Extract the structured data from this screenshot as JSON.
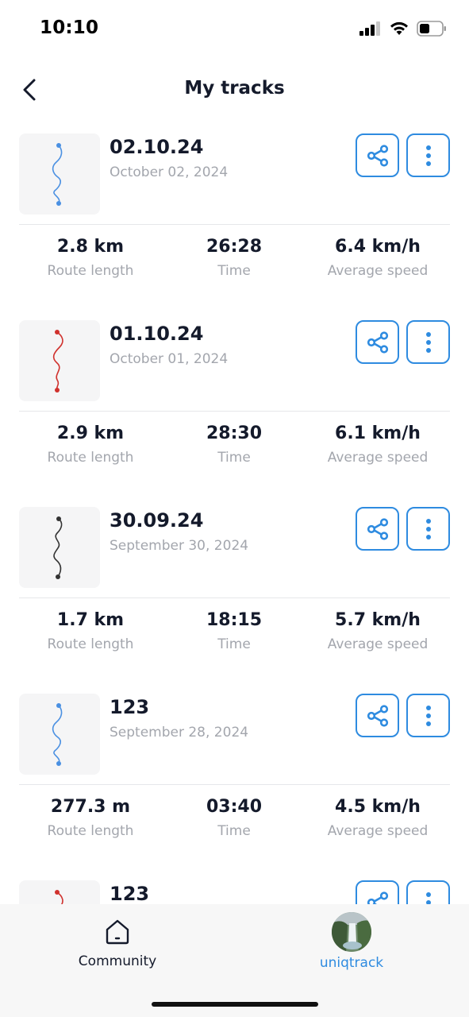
{
  "status_bar": {
    "time": "10:10"
  },
  "nav": {
    "title": "My tracks"
  },
  "labels": {
    "route_length": "Route length",
    "time": "Time",
    "average_speed": "Average speed"
  },
  "tracks": [
    {
      "title": "02.10.24",
      "date": "October 02, 2024",
      "length": "2.8 km",
      "time": "26:28",
      "speed": "6.4 km/h",
      "route_color": "#4a90e2"
    },
    {
      "title": "01.10.24",
      "date": "October 01, 2024",
      "length": "2.9 km",
      "time": "28:30",
      "speed": "6.1 km/h",
      "route_color": "#d0312d"
    },
    {
      "title": "30.09.24",
      "date": "September 30, 2024",
      "length": "1.7 km",
      "time": "18:15",
      "speed": "5.7 km/h",
      "route_color": "#333333"
    },
    {
      "title": "123",
      "date": "September 28, 2024",
      "length": "277.3 m",
      "time": "03:40",
      "speed": "4.5 km/h",
      "route_color": "#4a90e2"
    },
    {
      "title": "123",
      "route_color": "#d0312d"
    }
  ],
  "tabbar": {
    "community_label": "Community",
    "profile_label": "uniqtrack"
  },
  "colors": {
    "accent": "#2e8be0",
    "text": "#141a2b",
    "muted": "#a3a6ad"
  }
}
